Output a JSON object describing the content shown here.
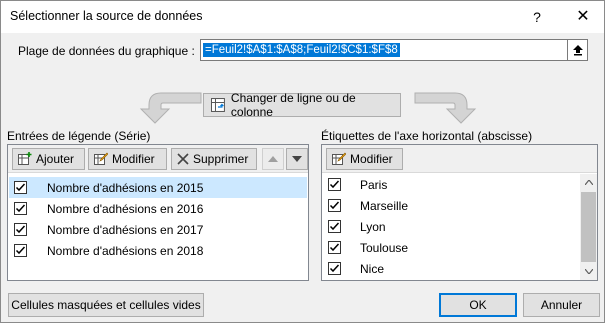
{
  "window": {
    "title": "Sélectionner la source de données",
    "help": "?",
    "close": "✕"
  },
  "range": {
    "label": "Plage de données du graphique :",
    "value": "=Feuil2!$A$1:$A$8;Feuil2!$C$1:$F$8"
  },
  "switch_button": "Changer de ligne ou de colonne",
  "legend": {
    "title": "Entrées de légende (Série)",
    "add": "Ajouter",
    "edit": "Modifier",
    "remove": "Supprimer",
    "items": [
      {
        "label": "Nombre d'adhésions en 2015",
        "checked": true,
        "selected": true
      },
      {
        "label": "Nombre d'adhésions en 2016",
        "checked": true,
        "selected": false
      },
      {
        "label": "Nombre d'adhésions en 2017",
        "checked": true,
        "selected": false
      },
      {
        "label": "Nombre d'adhésions en 2018",
        "checked": true,
        "selected": false
      }
    ]
  },
  "axis": {
    "title": "Étiquettes de l'axe horizontal (abscisse)",
    "edit": "Modifier",
    "items": [
      {
        "label": "Paris",
        "checked": true
      },
      {
        "label": "Marseille",
        "checked": true
      },
      {
        "label": "Lyon",
        "checked": true
      },
      {
        "label": "Toulouse",
        "checked": true
      },
      {
        "label": "Nice",
        "checked": true
      }
    ]
  },
  "footer": {
    "hidden_cells": "Cellules masquées et cellules vides",
    "ok": "OK",
    "cancel": "Annuler"
  },
  "colors": {
    "accent": "#0078d7",
    "selection": "#cce8ff"
  }
}
